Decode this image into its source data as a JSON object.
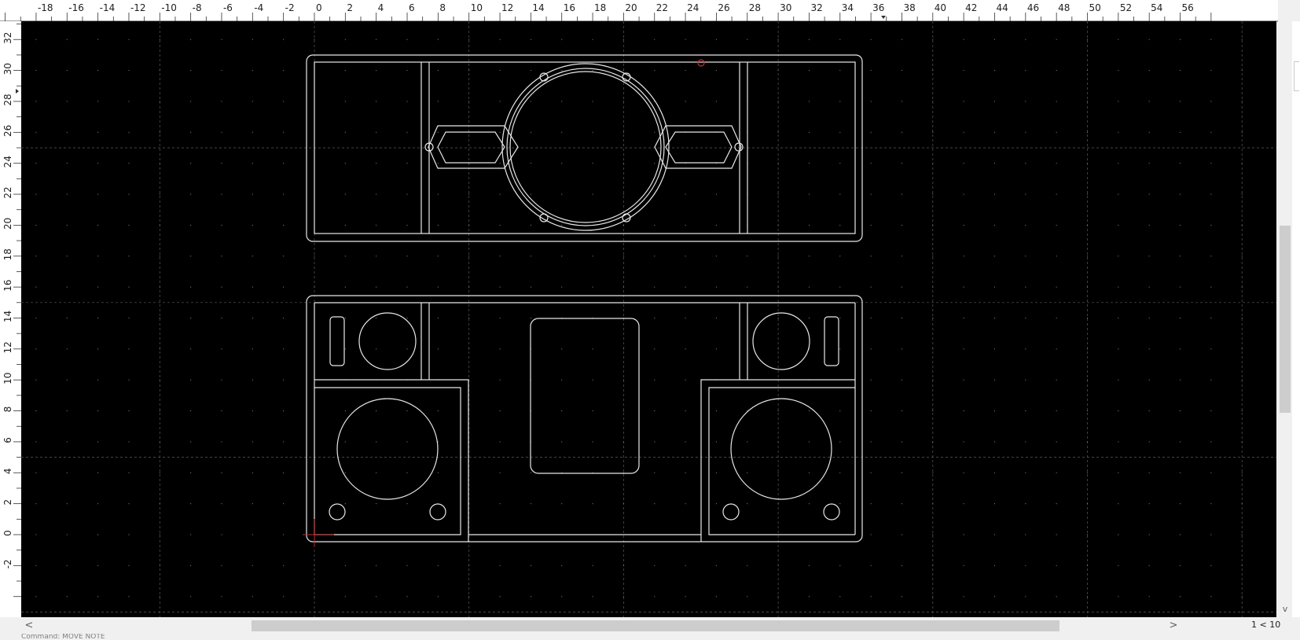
{
  "ruler": {
    "x_labels": [
      "-18",
      "-16",
      "-14",
      "-12",
      "-10",
      "-8",
      "-6",
      "-4",
      "-2",
      "0",
      "2",
      "4",
      "6",
      "8",
      "10",
      "12",
      "14",
      "16",
      "18",
      "20",
      "22",
      "24",
      "26",
      "28",
      "30",
      "32",
      "34",
      "36",
      "38",
      "40",
      "42",
      "44",
      "46",
      "48",
      "50",
      "52",
      "54",
      "56"
    ],
    "y_labels": [
      "32",
      "30",
      "28",
      "26",
      "24",
      "22",
      "20",
      "18",
      "16",
      "14",
      "12",
      "10",
      "8",
      "6",
      "4",
      "2",
      "0",
      "-2"
    ]
  },
  "status": {
    "page_indicator": "1 < 10",
    "command_hint": "Command: MOVE NOTE"
  },
  "scroll": {
    "left_arrow": "<",
    "right_arrow": ">",
    "down_arrow": "v"
  },
  "colors": {
    "canvas_bg": "#000000",
    "grid_major": "#5a5a5a",
    "grid_dot": "#8a8a8a",
    "geometry": "#e8e8e8",
    "marker": "#c03030",
    "ruler_bg": "#ffffff",
    "ruler_text": "#202020"
  }
}
